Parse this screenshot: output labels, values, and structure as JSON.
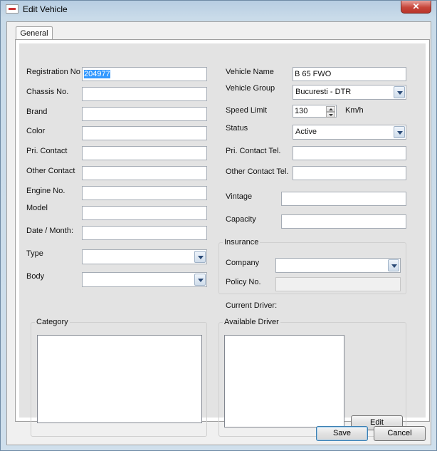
{
  "window": {
    "title": "Edit Vehicle",
    "close_label": "✕"
  },
  "tabs": [
    {
      "label": "General"
    }
  ],
  "left_fields": {
    "registration_label": "Registration No",
    "registration_value": "204977",
    "chassis_label": "Chassis No.",
    "brand_label": "Brand",
    "color_label": "Color",
    "pri_contact_label": "Pri. Contact",
    "other_contact_label": "Other Contact",
    "engine_label": "Engine No.",
    "model_label": "Model",
    "date_label": "Date / Month:",
    "type_label": "Type",
    "body_label": "Body"
  },
  "right_fields": {
    "vehicle_name_label": "Vehicle Name",
    "vehicle_name_value": "B 65 FWO",
    "vehicle_group_label": "Vehicle Group",
    "vehicle_group_value": "Bucuresti - DTR",
    "speed_limit_label": "Speed Limit",
    "speed_limit_value": "130",
    "speed_unit": "Km/h",
    "status_label": "Status",
    "status_value": "Active",
    "pri_contact_tel_label": "Pri. Contact Tel.",
    "other_contact_tel_label": "Other Contact Tel.",
    "vintage_label": "Vintage",
    "capacity_label": "Capacity"
  },
  "insurance": {
    "title": "Insurance",
    "company_label": "Company",
    "policy_label": "Policy No."
  },
  "current_driver_label": "Current Driver:",
  "category": {
    "title": "Category"
  },
  "available_driver": {
    "title": "Available Driver",
    "edit_label": "Edit"
  },
  "footer": {
    "save_label": "Save",
    "cancel_label": "Cancel"
  }
}
